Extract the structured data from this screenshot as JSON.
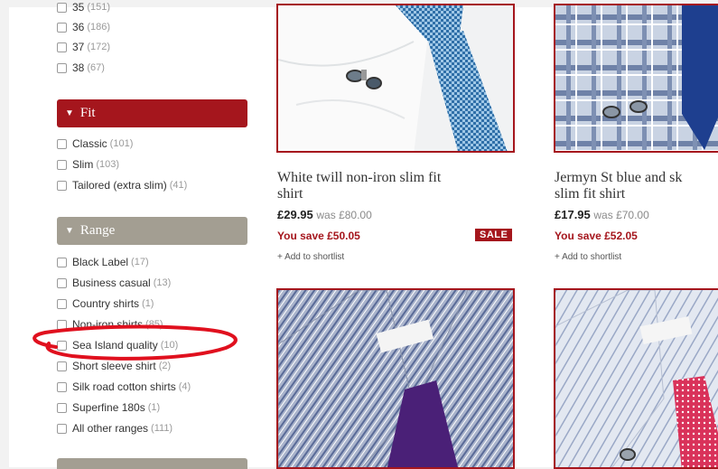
{
  "size_facet": {
    "items": [
      {
        "label": "35",
        "count": "(151)"
      },
      {
        "label": "36",
        "count": "(186)"
      },
      {
        "label": "37",
        "count": "(172)"
      },
      {
        "label": "38",
        "count": "(67)"
      }
    ]
  },
  "fit_facet": {
    "header": "Fit",
    "items": [
      {
        "label": "Classic",
        "count": "(101)"
      },
      {
        "label": "Slim",
        "count": "(103)"
      },
      {
        "label": "Tailored (extra slim)",
        "count": "(41)"
      }
    ]
  },
  "range_facet": {
    "header": "Range",
    "items": [
      {
        "label": "Black Label",
        "count": "(17)"
      },
      {
        "label": "Business casual",
        "count": "(13)"
      },
      {
        "label": "Country shirts",
        "count": "(1)"
      },
      {
        "label": "Non-iron shirts",
        "count": "(85)"
      },
      {
        "label": "Sea Island quality",
        "count": "(10)"
      },
      {
        "label": "Short sleeve shirt",
        "count": "(2)"
      },
      {
        "label": "Silk road cotton shirts",
        "count": "(4)"
      },
      {
        "label": "Superfine 180s",
        "count": "(1)"
      },
      {
        "label": "All other ranges",
        "count": "(111)"
      }
    ]
  },
  "products": [
    {
      "title_line1": "White twill non-iron slim fit",
      "title_line2": "shirt",
      "price": "£29.95",
      "was": "was £80.00",
      "save": "You save £50.05",
      "badge": "SALE",
      "shortlist": "+ Add to shortlist"
    },
    {
      "title_line1": "Jermyn St blue and sk",
      "title_line2": "slim fit shirt",
      "price": "£17.95",
      "was": "was £70.00",
      "save": "You save £52.05",
      "shortlist": "+ Add to shortlist"
    }
  ],
  "colors": {
    "accent": "#a5161d",
    "range_header": "#a39e92",
    "annotation": "#e0101e"
  }
}
